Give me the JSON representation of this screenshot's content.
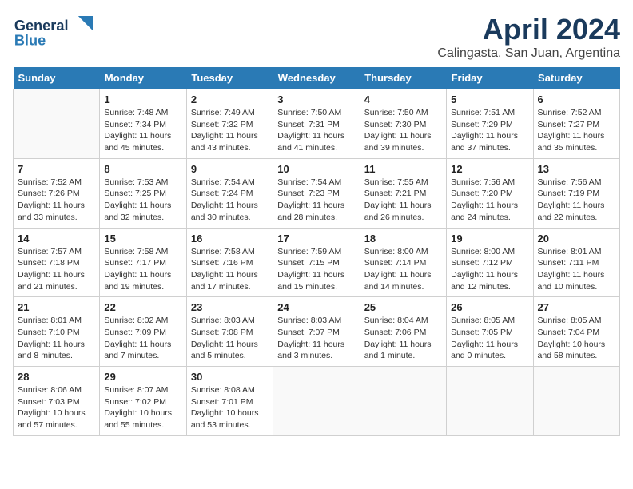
{
  "header": {
    "logo_line1": "General",
    "logo_line2": "Blue",
    "title": "April 2024",
    "subtitle": "Calingasta, San Juan, Argentina"
  },
  "calendar": {
    "days_of_week": [
      "Sunday",
      "Monday",
      "Tuesday",
      "Wednesday",
      "Thursday",
      "Friday",
      "Saturday"
    ],
    "weeks": [
      [
        {
          "day": "",
          "info": ""
        },
        {
          "day": "1",
          "info": "Sunrise: 7:48 AM\nSunset: 7:34 PM\nDaylight: 11 hours\nand 45 minutes."
        },
        {
          "day": "2",
          "info": "Sunrise: 7:49 AM\nSunset: 7:32 PM\nDaylight: 11 hours\nand 43 minutes."
        },
        {
          "day": "3",
          "info": "Sunrise: 7:50 AM\nSunset: 7:31 PM\nDaylight: 11 hours\nand 41 minutes."
        },
        {
          "day": "4",
          "info": "Sunrise: 7:50 AM\nSunset: 7:30 PM\nDaylight: 11 hours\nand 39 minutes."
        },
        {
          "day": "5",
          "info": "Sunrise: 7:51 AM\nSunset: 7:29 PM\nDaylight: 11 hours\nand 37 minutes."
        },
        {
          "day": "6",
          "info": "Sunrise: 7:52 AM\nSunset: 7:27 PM\nDaylight: 11 hours\nand 35 minutes."
        }
      ],
      [
        {
          "day": "7",
          "info": "Sunrise: 7:52 AM\nSunset: 7:26 PM\nDaylight: 11 hours\nand 33 minutes."
        },
        {
          "day": "8",
          "info": "Sunrise: 7:53 AM\nSunset: 7:25 PM\nDaylight: 11 hours\nand 32 minutes."
        },
        {
          "day": "9",
          "info": "Sunrise: 7:54 AM\nSunset: 7:24 PM\nDaylight: 11 hours\nand 30 minutes."
        },
        {
          "day": "10",
          "info": "Sunrise: 7:54 AM\nSunset: 7:23 PM\nDaylight: 11 hours\nand 28 minutes."
        },
        {
          "day": "11",
          "info": "Sunrise: 7:55 AM\nSunset: 7:21 PM\nDaylight: 11 hours\nand 26 minutes."
        },
        {
          "day": "12",
          "info": "Sunrise: 7:56 AM\nSunset: 7:20 PM\nDaylight: 11 hours\nand 24 minutes."
        },
        {
          "day": "13",
          "info": "Sunrise: 7:56 AM\nSunset: 7:19 PM\nDaylight: 11 hours\nand 22 minutes."
        }
      ],
      [
        {
          "day": "14",
          "info": "Sunrise: 7:57 AM\nSunset: 7:18 PM\nDaylight: 11 hours\nand 21 minutes."
        },
        {
          "day": "15",
          "info": "Sunrise: 7:58 AM\nSunset: 7:17 PM\nDaylight: 11 hours\nand 19 minutes."
        },
        {
          "day": "16",
          "info": "Sunrise: 7:58 AM\nSunset: 7:16 PM\nDaylight: 11 hours\nand 17 minutes."
        },
        {
          "day": "17",
          "info": "Sunrise: 7:59 AM\nSunset: 7:15 PM\nDaylight: 11 hours\nand 15 minutes."
        },
        {
          "day": "18",
          "info": "Sunrise: 8:00 AM\nSunset: 7:14 PM\nDaylight: 11 hours\nand 14 minutes."
        },
        {
          "day": "19",
          "info": "Sunrise: 8:00 AM\nSunset: 7:12 PM\nDaylight: 11 hours\nand 12 minutes."
        },
        {
          "day": "20",
          "info": "Sunrise: 8:01 AM\nSunset: 7:11 PM\nDaylight: 11 hours\nand 10 minutes."
        }
      ],
      [
        {
          "day": "21",
          "info": "Sunrise: 8:01 AM\nSunset: 7:10 PM\nDaylight: 11 hours\nand 8 minutes."
        },
        {
          "day": "22",
          "info": "Sunrise: 8:02 AM\nSunset: 7:09 PM\nDaylight: 11 hours\nand 7 minutes."
        },
        {
          "day": "23",
          "info": "Sunrise: 8:03 AM\nSunset: 7:08 PM\nDaylight: 11 hours\nand 5 minutes."
        },
        {
          "day": "24",
          "info": "Sunrise: 8:03 AM\nSunset: 7:07 PM\nDaylight: 11 hours\nand 3 minutes."
        },
        {
          "day": "25",
          "info": "Sunrise: 8:04 AM\nSunset: 7:06 PM\nDaylight: 11 hours\nand 1 minute."
        },
        {
          "day": "26",
          "info": "Sunrise: 8:05 AM\nSunset: 7:05 PM\nDaylight: 11 hours\nand 0 minutes."
        },
        {
          "day": "27",
          "info": "Sunrise: 8:05 AM\nSunset: 7:04 PM\nDaylight: 10 hours\nand 58 minutes."
        }
      ],
      [
        {
          "day": "28",
          "info": "Sunrise: 8:06 AM\nSunset: 7:03 PM\nDaylight: 10 hours\nand 57 minutes."
        },
        {
          "day": "29",
          "info": "Sunrise: 8:07 AM\nSunset: 7:02 PM\nDaylight: 10 hours\nand 55 minutes."
        },
        {
          "day": "30",
          "info": "Sunrise: 8:08 AM\nSunset: 7:01 PM\nDaylight: 10 hours\nand 53 minutes."
        },
        {
          "day": "",
          "info": ""
        },
        {
          "day": "",
          "info": ""
        },
        {
          "day": "",
          "info": ""
        },
        {
          "day": "",
          "info": ""
        }
      ]
    ]
  }
}
